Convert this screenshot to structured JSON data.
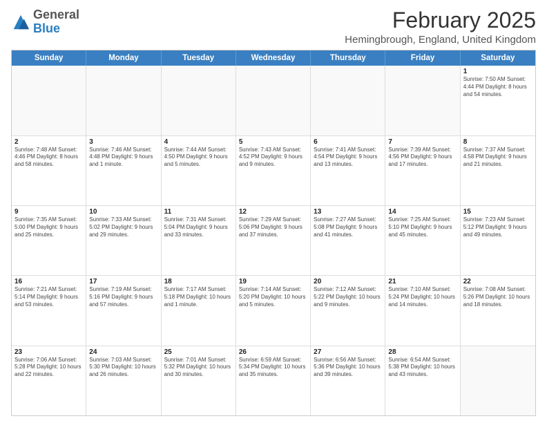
{
  "header": {
    "logo": {
      "general": "General",
      "blue": "Blue"
    },
    "title": "February 2025",
    "location": "Hemingbrough, England, United Kingdom"
  },
  "days_of_week": [
    "Sunday",
    "Monday",
    "Tuesday",
    "Wednesday",
    "Thursday",
    "Friday",
    "Saturday"
  ],
  "weeks": [
    {
      "cells": [
        {
          "day": "",
          "info": "",
          "empty": true
        },
        {
          "day": "",
          "info": "",
          "empty": true
        },
        {
          "day": "",
          "info": "",
          "empty": true
        },
        {
          "day": "",
          "info": "",
          "empty": true
        },
        {
          "day": "",
          "info": "",
          "empty": true
        },
        {
          "day": "",
          "info": "",
          "empty": true
        },
        {
          "day": "1",
          "info": "Sunrise: 7:50 AM\nSunset: 4:44 PM\nDaylight: 8 hours and 54 minutes.",
          "empty": false
        }
      ]
    },
    {
      "cells": [
        {
          "day": "2",
          "info": "Sunrise: 7:48 AM\nSunset: 4:46 PM\nDaylight: 8 hours and 58 minutes.",
          "empty": false
        },
        {
          "day": "3",
          "info": "Sunrise: 7:46 AM\nSunset: 4:48 PM\nDaylight: 9 hours and 1 minute.",
          "empty": false
        },
        {
          "day": "4",
          "info": "Sunrise: 7:44 AM\nSunset: 4:50 PM\nDaylight: 9 hours and 5 minutes.",
          "empty": false
        },
        {
          "day": "5",
          "info": "Sunrise: 7:43 AM\nSunset: 4:52 PM\nDaylight: 9 hours and 9 minutes.",
          "empty": false
        },
        {
          "day": "6",
          "info": "Sunrise: 7:41 AM\nSunset: 4:54 PM\nDaylight: 9 hours and 13 minutes.",
          "empty": false
        },
        {
          "day": "7",
          "info": "Sunrise: 7:39 AM\nSunset: 4:56 PM\nDaylight: 9 hours and 17 minutes.",
          "empty": false
        },
        {
          "day": "8",
          "info": "Sunrise: 7:37 AM\nSunset: 4:58 PM\nDaylight: 9 hours and 21 minutes.",
          "empty": false
        }
      ]
    },
    {
      "cells": [
        {
          "day": "9",
          "info": "Sunrise: 7:35 AM\nSunset: 5:00 PM\nDaylight: 9 hours and 25 minutes.",
          "empty": false
        },
        {
          "day": "10",
          "info": "Sunrise: 7:33 AM\nSunset: 5:02 PM\nDaylight: 9 hours and 29 minutes.",
          "empty": false
        },
        {
          "day": "11",
          "info": "Sunrise: 7:31 AM\nSunset: 5:04 PM\nDaylight: 9 hours and 33 minutes.",
          "empty": false
        },
        {
          "day": "12",
          "info": "Sunrise: 7:29 AM\nSunset: 5:06 PM\nDaylight: 9 hours and 37 minutes.",
          "empty": false
        },
        {
          "day": "13",
          "info": "Sunrise: 7:27 AM\nSunset: 5:08 PM\nDaylight: 9 hours and 41 minutes.",
          "empty": false
        },
        {
          "day": "14",
          "info": "Sunrise: 7:25 AM\nSunset: 5:10 PM\nDaylight: 9 hours and 45 minutes.",
          "empty": false
        },
        {
          "day": "15",
          "info": "Sunrise: 7:23 AM\nSunset: 5:12 PM\nDaylight: 9 hours and 49 minutes.",
          "empty": false
        }
      ]
    },
    {
      "cells": [
        {
          "day": "16",
          "info": "Sunrise: 7:21 AM\nSunset: 5:14 PM\nDaylight: 9 hours and 53 minutes.",
          "empty": false
        },
        {
          "day": "17",
          "info": "Sunrise: 7:19 AM\nSunset: 5:16 PM\nDaylight: 9 hours and 57 minutes.",
          "empty": false
        },
        {
          "day": "18",
          "info": "Sunrise: 7:17 AM\nSunset: 5:18 PM\nDaylight: 10 hours and 1 minute.",
          "empty": false
        },
        {
          "day": "19",
          "info": "Sunrise: 7:14 AM\nSunset: 5:20 PM\nDaylight: 10 hours and 5 minutes.",
          "empty": false
        },
        {
          "day": "20",
          "info": "Sunrise: 7:12 AM\nSunset: 5:22 PM\nDaylight: 10 hours and 9 minutes.",
          "empty": false
        },
        {
          "day": "21",
          "info": "Sunrise: 7:10 AM\nSunset: 5:24 PM\nDaylight: 10 hours and 14 minutes.",
          "empty": false
        },
        {
          "day": "22",
          "info": "Sunrise: 7:08 AM\nSunset: 5:26 PM\nDaylight: 10 hours and 18 minutes.",
          "empty": false
        }
      ]
    },
    {
      "cells": [
        {
          "day": "23",
          "info": "Sunrise: 7:06 AM\nSunset: 5:28 PM\nDaylight: 10 hours and 22 minutes.",
          "empty": false
        },
        {
          "day": "24",
          "info": "Sunrise: 7:03 AM\nSunset: 5:30 PM\nDaylight: 10 hours and 26 minutes.",
          "empty": false
        },
        {
          "day": "25",
          "info": "Sunrise: 7:01 AM\nSunset: 5:32 PM\nDaylight: 10 hours and 30 minutes.",
          "empty": false
        },
        {
          "day": "26",
          "info": "Sunrise: 6:59 AM\nSunset: 5:34 PM\nDaylight: 10 hours and 35 minutes.",
          "empty": false
        },
        {
          "day": "27",
          "info": "Sunrise: 6:56 AM\nSunset: 5:36 PM\nDaylight: 10 hours and 39 minutes.",
          "empty": false
        },
        {
          "day": "28",
          "info": "Sunrise: 6:54 AM\nSunset: 5:38 PM\nDaylight: 10 hours and 43 minutes.",
          "empty": false
        },
        {
          "day": "",
          "info": "",
          "empty": true
        }
      ]
    }
  ]
}
